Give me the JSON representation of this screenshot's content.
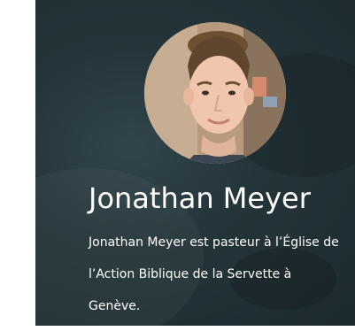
{
  "profile": {
    "name": "Jonathan Meyer",
    "bio": "Jonathan Meyer est pasteur à l’Église de l’Action Biblique de la Servette à Genève.",
    "photo_icon": "person-portrait"
  },
  "colors": {
    "background": "#24353a",
    "text": "#ffffff"
  }
}
